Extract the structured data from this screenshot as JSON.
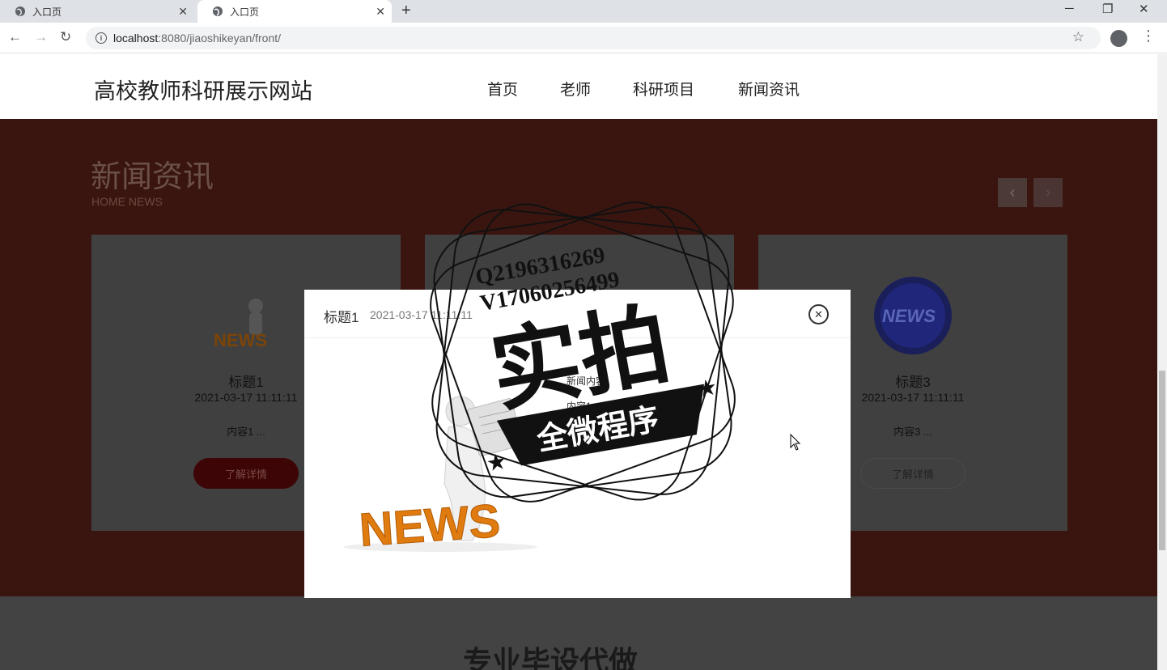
{
  "browser": {
    "tabs": [
      {
        "label": "入口页",
        "active": false
      },
      {
        "label": "入口页",
        "active": true
      }
    ],
    "url_host": "localhost",
    "url_path": ":8080/jiaoshikeyan/front/"
  },
  "site": {
    "title": "高校教师科研展示网站",
    "nav": [
      "首页",
      "老师",
      "科研项目",
      "新闻资讯"
    ]
  },
  "news": {
    "heading": "新闻资讯",
    "subheading": "HOME NEWS",
    "cards": [
      {
        "title": "标题1",
        "date": "2021-03-17 11:11:11",
        "excerpt": "内容1 ...",
        "button": "了解详情",
        "thumb": "news-3d-figure"
      },
      {
        "title": "标题3",
        "date": "2021-03-17 11:11:11",
        "excerpt": "内容3 ...",
        "button": "了解详情",
        "thumb": "news-blue-badge"
      }
    ]
  },
  "modal": {
    "title": "标题1",
    "date": "2021-03-17 11:11:11",
    "label": "新闻内容",
    "content": "内容1",
    "image": "news-reader-figure"
  },
  "watermark": {
    "line1": "Q2196316269",
    "line2": "V17060256499",
    "main": "实拍",
    "ribbon": "全微程序"
  },
  "footer": {
    "text": "专业毕设代做"
  },
  "colors": {
    "news_bg": "#3a150f",
    "overlay_card": "#404040",
    "button_red": "#3d0506",
    "accent_orange": "#e07b10"
  }
}
